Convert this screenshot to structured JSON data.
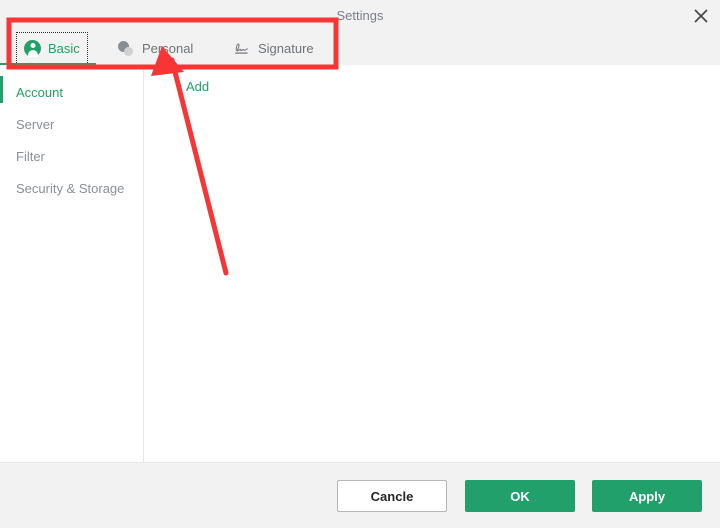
{
  "window": {
    "title": "Settings",
    "close_icon": "close-icon"
  },
  "tabs": [
    {
      "label": "Basic",
      "icon": "avatar-icon",
      "active": true,
      "focused": true
    },
    {
      "label": "Personal",
      "icon": "person-icon",
      "active": false,
      "focused": false
    },
    {
      "label": "Signature",
      "icon": "signature-icon",
      "active": false,
      "focused": false
    }
  ],
  "sidebar": {
    "items": [
      {
        "label": "Account",
        "active": true
      },
      {
        "label": "Server",
        "active": false
      },
      {
        "label": "Filter",
        "active": false
      },
      {
        "label": "Security & Storage",
        "active": false
      }
    ]
  },
  "content": {
    "add_label": "Add"
  },
  "footer": {
    "cancel_label": "Cancle",
    "ok_label": "OK",
    "apply_label": "Apply"
  },
  "annotations": {
    "highlight_box": "red-rectangle-around-tab-bar",
    "arrow": "red-arrow-pointing-to-tabs"
  },
  "colors": {
    "accent_green": "#22a06b",
    "annotation_red": "#f83535",
    "chrome_gray": "#f2f2f2",
    "muted_text": "#8b9096"
  }
}
